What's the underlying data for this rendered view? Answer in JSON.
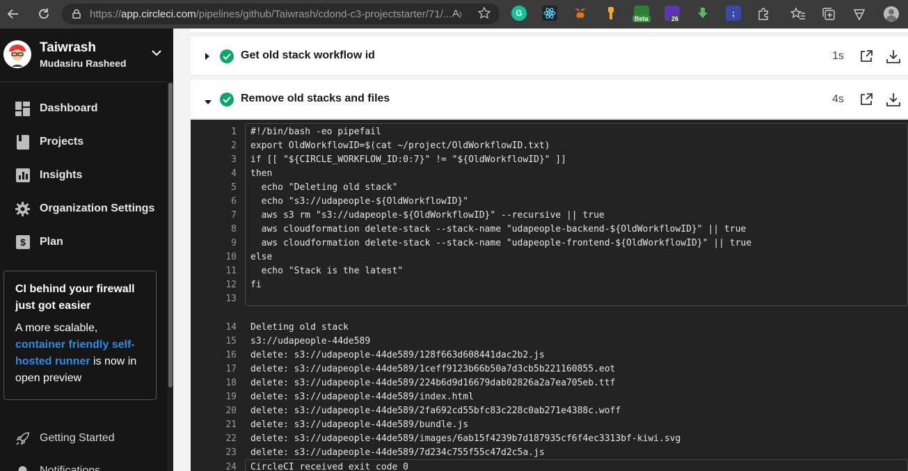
{
  "browser": {
    "url_protocol": "https://",
    "url_host": "app.circleci.com",
    "url_path": "/pipelines/github/Taiwrash/cdond-c3-projectstarter/71/...",
    "extension_badges": {
      "beta": "Beta",
      "count": "26"
    }
  },
  "sidebar": {
    "user_name": "Taiwrash",
    "user_fullname": "Mudasiru Rasheed",
    "nav": [
      {
        "label": "Dashboard",
        "icon": "dashboard-icon"
      },
      {
        "label": "Projects",
        "icon": "projects-icon"
      },
      {
        "label": "Insights",
        "icon": "insights-icon"
      },
      {
        "label": "Organization Settings",
        "icon": "gear-icon"
      },
      {
        "label": "Plan",
        "icon": "dollar-icon"
      }
    ],
    "promo": {
      "title": "CI behind your firewall just got easier",
      "body_prefix": "A more scalable, ",
      "link": "container friendly self-hosted runner",
      "body_suffix": " is now in open preview"
    },
    "bottom": [
      {
        "label": "Getting Started",
        "icon": "rocket-icon"
      },
      {
        "label": "Notifications",
        "icon": "bell-icon"
      }
    ]
  },
  "steps": [
    {
      "title": "Get old stack workflow id",
      "duration": "1s",
      "expanded": false
    },
    {
      "title": "Remove old stacks and files",
      "duration": "4s",
      "expanded": true
    }
  ],
  "console": {
    "lines": [
      {
        "n": "1",
        "t": "#!/bin/bash -eo pipefail"
      },
      {
        "n": "2",
        "t": "export OldWorkflowID=$(cat ~/project/OldWorkflowID.txt)"
      },
      {
        "n": "3",
        "t": "if [[ \"${CIRCLE_WORKFLOW_ID:0:7}\" != \"${OldWorkflowID}\" ]]"
      },
      {
        "n": "4",
        "t": "then"
      },
      {
        "n": "5",
        "t": "  echo \"Deleting old stack\""
      },
      {
        "n": "6",
        "t": "  echo \"s3://udapeople-${OldWorkflowID}\""
      },
      {
        "n": "7",
        "t": "  aws s3 rm \"s3://udapeople-${OldWorkflowID}\" --recursive || true"
      },
      {
        "n": "8",
        "t": "  aws cloudformation delete-stack --stack-name \"udapeople-backend-${OldWorkflowID}\" || true"
      },
      {
        "n": "9",
        "t": "  aws cloudformation delete-stack --stack-name \"udapeople-frontend-${OldWorkflowID}\" || true"
      },
      {
        "n": "10",
        "t": "else"
      },
      {
        "n": "11",
        "t": "  echo \"Stack is the latest\""
      },
      {
        "n": "12",
        "t": "fi"
      },
      {
        "n": "13",
        "t": ""
      },
      {
        "n": "14",
        "t": "Deleting old stack"
      },
      {
        "n": "15",
        "t": "s3://udapeople-44de589"
      },
      {
        "n": "16",
        "t": "delete: s3://udapeople-44de589/128f663d608441dac2b2.js"
      },
      {
        "n": "17",
        "t": "delete: s3://udapeople-44de589/1ceff9123b66b50a7d3cb5b221160855.eot"
      },
      {
        "n": "18",
        "t": "delete: s3://udapeople-44de589/224b6d9d16679dab02826a2a7ea705eb.ttf"
      },
      {
        "n": "19",
        "t": "delete: s3://udapeople-44de589/index.html"
      },
      {
        "n": "20",
        "t": "delete: s3://udapeople-44de589/2fa692cd55bfc83c228c0ab271e4388c.woff"
      },
      {
        "n": "21",
        "t": "delete: s3://udapeople-44de589/bundle.js"
      },
      {
        "n": "22",
        "t": "delete: s3://udapeople-44de589/images/6ab15f4239b7d187935cf6f4ec3313bf-kiwi.svg"
      },
      {
        "n": "23",
        "t": "delete: s3://udapeople-44de589/7d234c755f55c47d2c5a.js"
      },
      {
        "n": "24",
        "t": "CircleCI received exit code 0"
      }
    ]
  },
  "colors": {
    "success": "#0ea46a",
    "link": "#2f8be6",
    "sidebar_bg": "#161616",
    "console_bg": "#232323"
  }
}
